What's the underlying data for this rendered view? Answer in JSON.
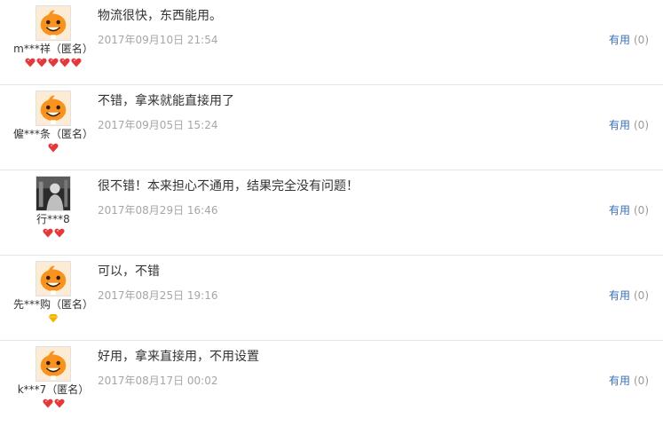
{
  "reviews": [
    {
      "avatar_icon": "orange-mascot-avatar-icon",
      "user": "m***祥（匿名）",
      "rank_icon": "red-heart-icon",
      "rank_count": 5,
      "content": "物流很快，东西能用。",
      "date": "2017年09月10日 21:54",
      "useful_label": "有用",
      "useful_count": "(0)"
    },
    {
      "avatar_icon": "orange-mascot-avatar-icon",
      "user": "僱***条（匿名）",
      "rank_icon": "red-heart-icon",
      "rank_count": 1,
      "content": "不错，拿来就能直接用了",
      "date": "2017年09月05日 15:24",
      "useful_label": "有用",
      "useful_count": "(0)"
    },
    {
      "avatar_icon": "photo-avatar-icon",
      "user": "行***8",
      "rank_icon": "red-heart-icon",
      "rank_count": 2,
      "content": "很不错！本来担心不通用，结果完全没有问题！",
      "date": "2017年08月29日 16:46",
      "useful_label": "有用",
      "useful_count": "(0)"
    },
    {
      "avatar_icon": "orange-mascot-avatar-icon",
      "user": "先***购（匿名）",
      "rank_icon": "yellow-diamond-icon",
      "rank_count": 1,
      "content": "可以，不错",
      "date": "2017年08月25日 19:16",
      "useful_label": "有用",
      "useful_count": "(0)"
    },
    {
      "avatar_icon": "orange-mascot-avatar-icon",
      "user": "k***7（匿名）",
      "rank_icon": "red-heart-icon",
      "rank_count": 2,
      "content": "好用，拿来直接用，不用设置",
      "date": "2017年08月17日 00:02",
      "useful_label": "有用",
      "useful_count": "(0)"
    }
  ],
  "colors": {
    "link": "#3c6eb4",
    "date": "#a6a6a6",
    "count": "#999999",
    "heart": "#e4393c",
    "diamond": "#f0b400",
    "mascot": "#f7931e"
  }
}
